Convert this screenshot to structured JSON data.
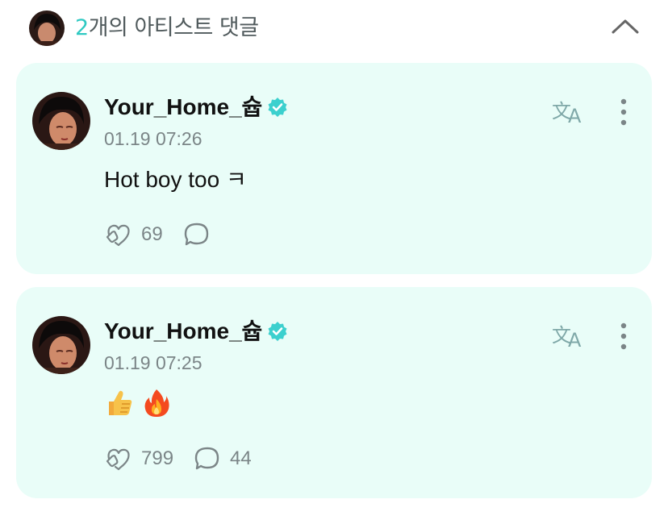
{
  "header": {
    "count": "2",
    "title_suffix": "개의 아티스트 댓글"
  },
  "colors": {
    "accent": "#2fc9c2",
    "card_bg": "#e9fdf8",
    "muted": "#7b8587",
    "verified": "#3cd0ce"
  },
  "comments": [
    {
      "author": "Your_Home_슙",
      "time": "01.19 07:26",
      "text": "Hot boy too ㅋ",
      "likes": "69",
      "replies": ""
    },
    {
      "author": "Your_Home_슙",
      "time": "01.19 07:25",
      "emojis": [
        "thumbs-up",
        "fire"
      ],
      "likes": "799",
      "replies": "44"
    }
  ],
  "icons": {
    "collapse": "chevron-up-icon",
    "verified": "verified-badge-icon",
    "translate": "translate-icon",
    "more": "more-vertical-icon",
    "like": "heart-hand-icon",
    "reply": "comment-bubble-icon"
  }
}
